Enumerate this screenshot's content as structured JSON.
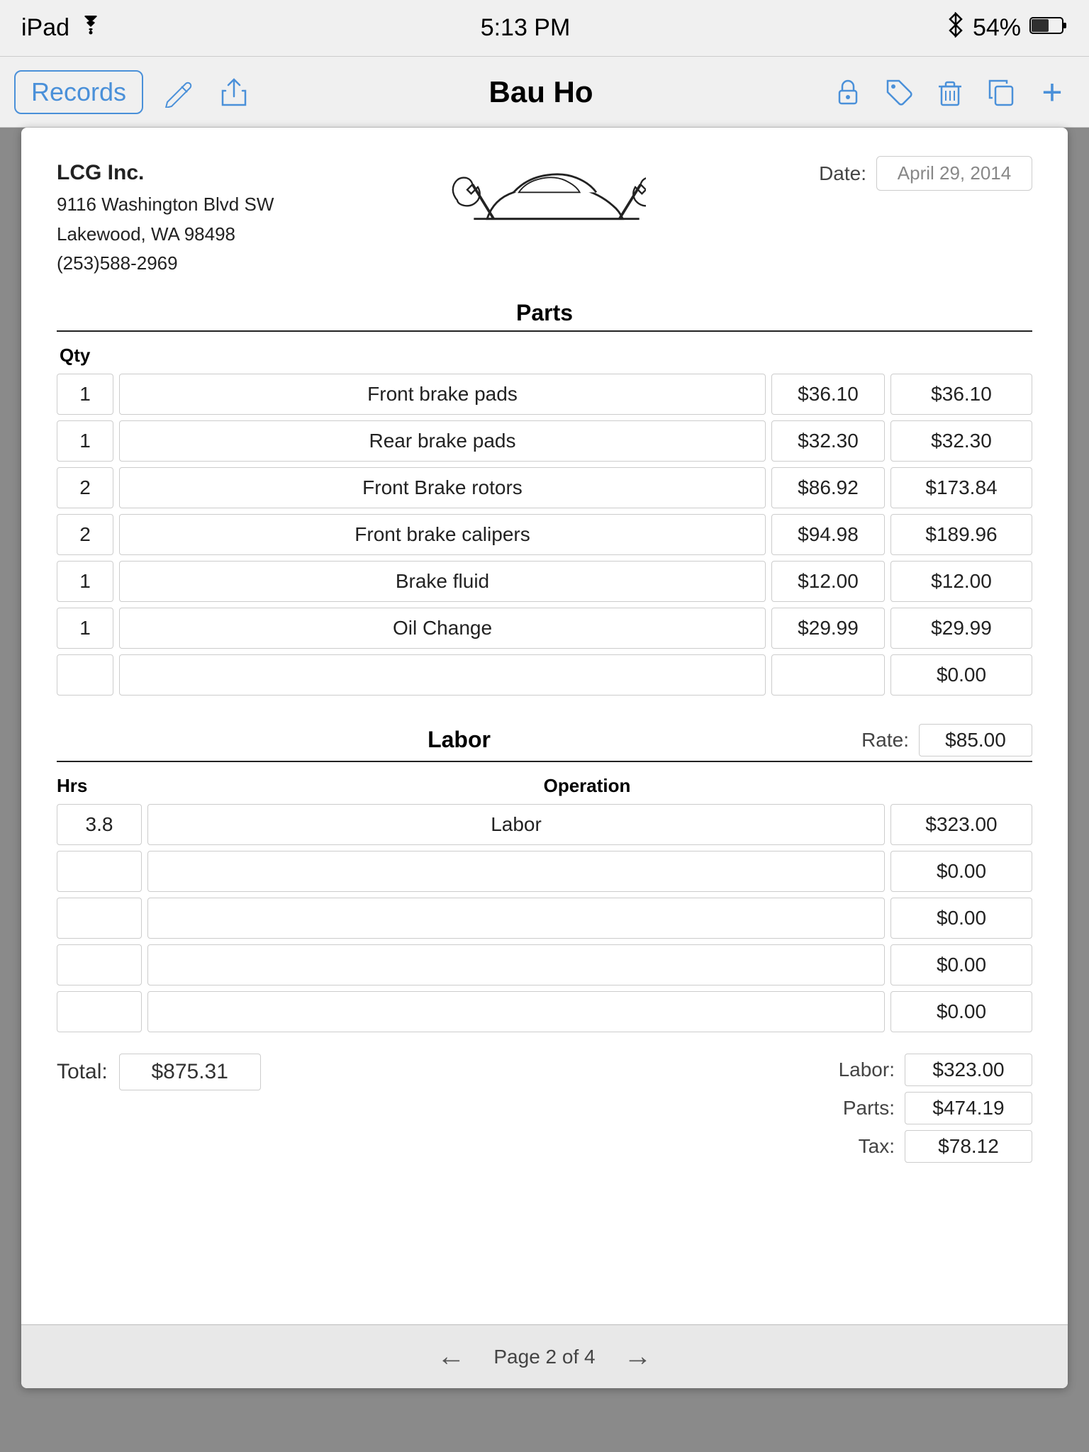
{
  "statusBar": {
    "device": "iPad",
    "wifi": "wifi",
    "time": "5:13 PM",
    "bluetooth": "bluetooth",
    "battery": "54%"
  },
  "toolbar": {
    "recordsLabel": "Records",
    "title": "Bau Ho",
    "icons": {
      "edit": "pencil",
      "share": "share",
      "lock": "lock",
      "tag": "tag",
      "trash": "trash",
      "copy": "copy",
      "add": "+"
    }
  },
  "invoice": {
    "company": {
      "name": "LCG Inc.",
      "address1": "9116 Washington Blvd SW",
      "address2": "Lakewood, WA  98498",
      "phone": "(253)588-2969"
    },
    "date": {
      "label": "Date:",
      "value": "April 29, 2014"
    },
    "partsSection": {
      "title": "Parts",
      "qtyLabel": "Qty",
      "rows": [
        {
          "qty": "1",
          "description": "Front brake pads",
          "price": "$36.10",
          "total": "$36.10"
        },
        {
          "qty": "1",
          "description": "Rear brake pads",
          "price": "$32.30",
          "total": "$32.30"
        },
        {
          "qty": "2",
          "description": "Front Brake rotors",
          "price": "$86.92",
          "total": "$173.84"
        },
        {
          "qty": "2",
          "description": "Front brake calipers",
          "price": "$94.98",
          "total": "$189.96"
        },
        {
          "qty": "1",
          "description": "Brake fluid",
          "price": "$12.00",
          "total": "$12.00"
        },
        {
          "qty": "1",
          "description": "Oil Change",
          "price": "$29.99",
          "total": "$29.99"
        },
        {
          "qty": "",
          "description": "",
          "price": "",
          "total": "$0.00"
        }
      ]
    },
    "laborSection": {
      "title": "Labor",
      "rateLabel": "Rate:",
      "rateValue": "$85.00",
      "hrsLabel": "Hrs",
      "operationLabel": "Operation",
      "rows": [
        {
          "hrs": "3.8",
          "operation": "Labor",
          "amount": "$323.00"
        },
        {
          "hrs": "",
          "operation": "",
          "amount": "$0.00"
        },
        {
          "hrs": "",
          "operation": "",
          "amount": "$0.00"
        },
        {
          "hrs": "",
          "operation": "",
          "amount": "$0.00"
        },
        {
          "hrs": "",
          "operation": "",
          "amount": "$0.00"
        }
      ]
    },
    "totals": {
      "totalLabel": "Total:",
      "totalValue": "$875.31",
      "laborLabel": "Labor:",
      "laborValue": "$323.00",
      "partsLabel": "Parts:",
      "partsValue": "$474.19",
      "taxLabel": "Tax:",
      "taxValue": "$78.12"
    }
  },
  "pagination": {
    "text": "Page 2 of 4",
    "prevArrow": "←",
    "nextArrow": "→"
  }
}
